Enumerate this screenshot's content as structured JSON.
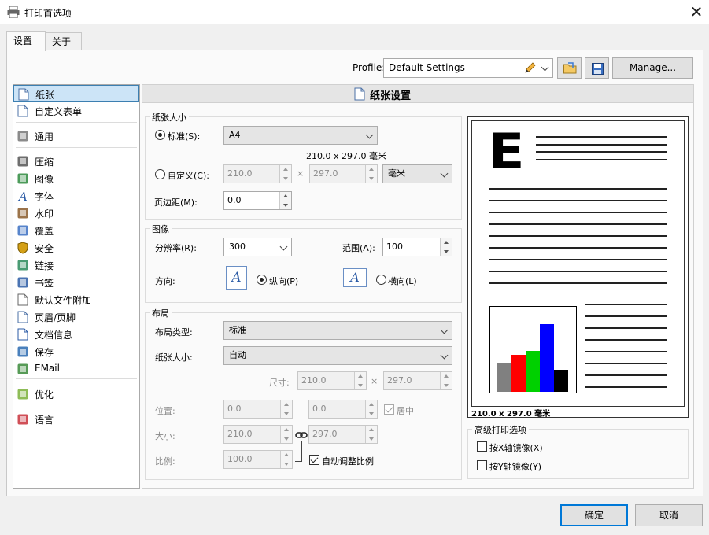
{
  "window": {
    "title": "打印首选项"
  },
  "tabs": [
    {
      "label": "设置"
    },
    {
      "label": "关于"
    }
  ],
  "profile": {
    "label": "Profile:",
    "value": "Default Settings",
    "manage_label": "Manage..."
  },
  "panel_title": "纸张设置",
  "sidebar": {
    "items": [
      {
        "label": "纸张",
        "icon": "page-icon"
      },
      {
        "label": "自定义表单",
        "icon": "form-icon"
      },
      {
        "label": "通用",
        "icon": "gears-icon"
      },
      {
        "label": "压缩",
        "icon": "compress-icon"
      },
      {
        "label": "图像",
        "icon": "image-icon"
      },
      {
        "label": "字体",
        "icon": "font-icon"
      },
      {
        "label": "水印",
        "icon": "watermark-icon"
      },
      {
        "label": "覆盖",
        "icon": "overlay-icon"
      },
      {
        "label": "安全",
        "icon": "shield-icon"
      },
      {
        "label": "链接",
        "icon": "link-icon"
      },
      {
        "label": "书签",
        "icon": "bookmark-icon"
      },
      {
        "label": "默认文件附加",
        "icon": "attach-icon"
      },
      {
        "label": "页眉/页脚",
        "icon": "header-footer-icon"
      },
      {
        "label": "文档信息",
        "icon": "docinfo-icon"
      },
      {
        "label": "保存",
        "icon": "save-icon"
      },
      {
        "label": "EMail",
        "icon": "email-icon"
      },
      {
        "label": "优化",
        "icon": "optimize-icon"
      },
      {
        "label": "语言",
        "icon": "language-icon"
      }
    ]
  },
  "paper_size": {
    "title": "纸张大小",
    "standard_label": "标准(S):",
    "standard_value": "A4",
    "dimension_text": "210.0 x 297.0 毫米",
    "custom_label": "自定义(C):",
    "custom_w": "210.0",
    "custom_h": "297.0",
    "times": "×",
    "unit": "毫米",
    "margin_label": "页边距(M):",
    "margin_value": "0.0"
  },
  "image": {
    "title": "图像",
    "resolution_label": "分辨率(R):",
    "resolution_value": "300",
    "range_label": "范围(A):",
    "range_value": "100",
    "orientation_label": "方向:",
    "portrait_label": "纵向(P)",
    "landscape_label": "横向(L)",
    "glyph": "A"
  },
  "layout": {
    "title": "布局",
    "type_label": "布局类型:",
    "type_value": "标准",
    "size_label": "纸张大小:",
    "size_value": "自动",
    "dim_label": "尺寸:",
    "dim_w": "210.0",
    "dim_h": "297.0",
    "pos_label": "位置:",
    "pos_x": "0.0",
    "pos_y": "0.0",
    "center_label": "居中",
    "size2_label": "大小:",
    "size_w": "210.0",
    "size_h": "297.0",
    "scale_label": "比例:",
    "scale_value": "100.0",
    "auto_scale_label": "自动调整比例"
  },
  "preview": {
    "caption": "210.0 x 297.0 毫米",
    "letter": "E",
    "bar_values": [
      0.37,
      0.47,
      0.52,
      0.86,
      0.28
    ],
    "bar_colors": [
      "#808080",
      "#ff0000",
      "#00d000",
      "#0000ff",
      "#000000"
    ]
  },
  "advanced": {
    "title": "高级打印选项",
    "mirror_x": "按X轴镜像(X)",
    "mirror_y": "按Y轴镜像(Y)"
  },
  "footer": {
    "ok": "确定",
    "cancel": "取消"
  }
}
